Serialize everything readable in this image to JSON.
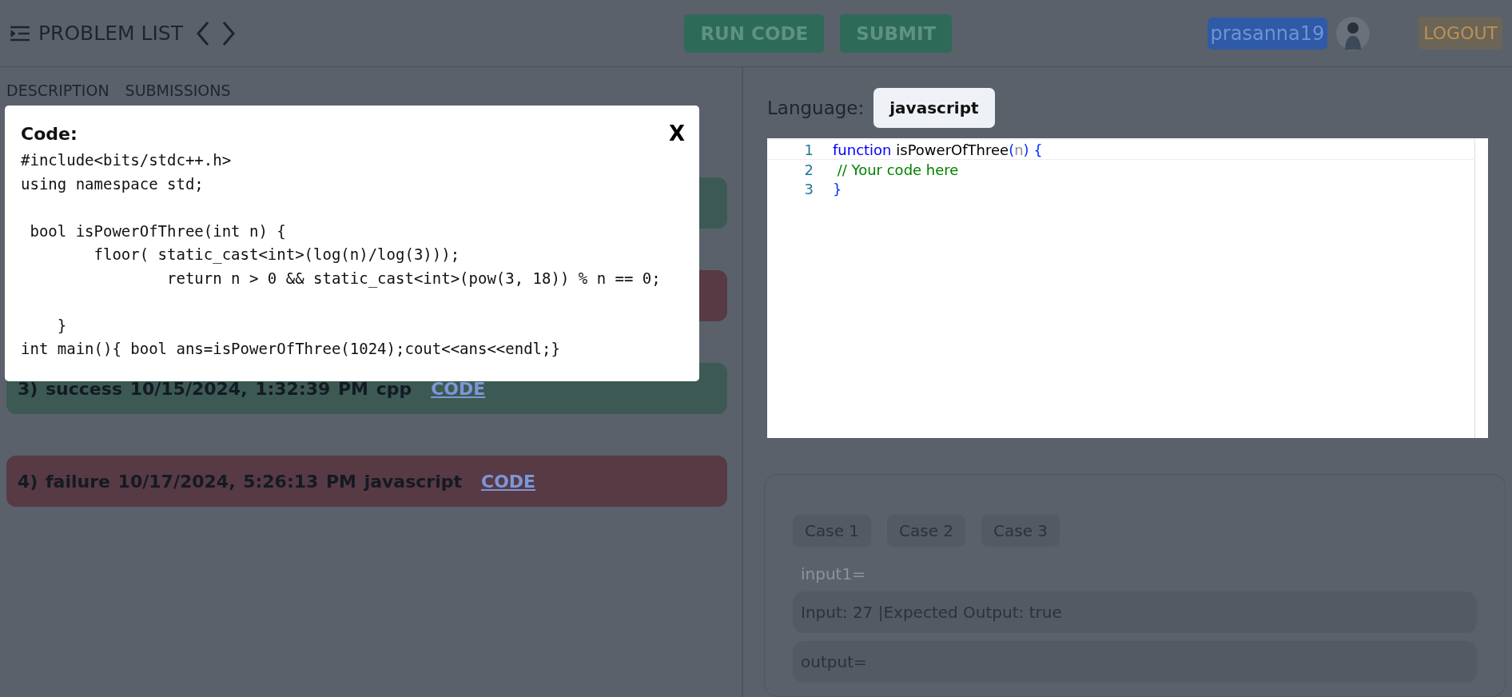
{
  "header": {
    "title": "PROBLEM LIST",
    "buttons": [
      "RUN CODE",
      "SUBMIT"
    ],
    "username": "prasanna19",
    "logout": "LOGOUT"
  },
  "left_tabs": [
    {
      "label": "DESCRIPTION"
    },
    {
      "label": "SUBMISSIONS"
    }
  ],
  "submissions": [
    {
      "color": "#3c5a53"
    },
    {
      "color": "#573a44"
    },
    {
      "color": "#3c5a53",
      "text": "3) success 10/15/2024, 1:32:39 PM cpp",
      "link": "CODE"
    },
    {
      "color": "#573a44",
      "text": "4) failure 10/17/2024, 5:26:13 PM javascript",
      "link": "CODE"
    }
  ],
  "modal": {
    "title": "Code:",
    "close": "X",
    "code": "#include<bits/stdc++.h>\nusing namespace std;\n\n bool isPowerOfThree(int n) {\n        floor( static_cast<int>(log(n)/log(3)));\n                return n > 0 && static_cast<int>(pow(3, 18)) % n == 0;\n\n    }\nint main(){ bool ans=isPowerOfThree(1024);cout<<ans<<endl;}"
  },
  "editor": {
    "language_label": "Language:",
    "language": "javascript",
    "lines": [
      {
        "number": "1",
        "tokens": [
          {
            "kind": "keyword",
            "text": "function"
          },
          {
            "kind": "plain",
            "text": " isPowerOfThree"
          },
          {
            "kind": "punct",
            "text": "("
          },
          {
            "kind": "param",
            "text": "n"
          },
          {
            "kind": "punct",
            "text": ") {"
          }
        ]
      },
      {
        "number": "2",
        "tokens": [
          {
            "kind": "comment",
            "text": " // Your code here"
          }
        ]
      },
      {
        "number": "3",
        "tokens": [
          {
            "kind": "punct",
            "text": "}"
          }
        ]
      }
    ]
  },
  "tests": {
    "cases": [
      "Case 1",
      "Case 2",
      "Case 3"
    ],
    "input_label": "input1=",
    "input_value": "Input: 27 |Expected Output: true",
    "output_label": "output="
  }
}
